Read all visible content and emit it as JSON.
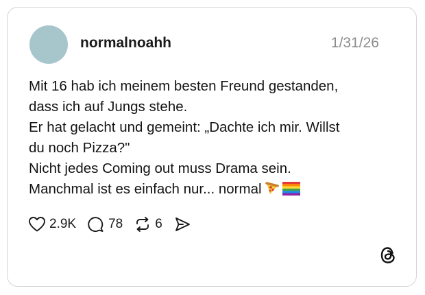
{
  "post": {
    "username": "normalnoahh",
    "date": "1/31/26",
    "lines": [
      "Mit 16 hab ich meinem besten Freund gestanden,",
      "dass ich auf Jungs stehe.",
      "Er hat gelacht und gemeint: „Dachte ich mir. Willst",
      "du noch Pizza?\"",
      "Nicht jedes Coming out muss Drama sein.",
      "Manchmal ist es einfach nur... normal"
    ],
    "emojis": [
      "pizza-emoji",
      "rainbow-flag-emoji"
    ]
  },
  "actions": {
    "likes": "2.9K",
    "replies": "78",
    "reposts": "6",
    "icons": [
      "heart-icon",
      "reply-bubble-icon",
      "repost-icon",
      "share-icon"
    ]
  },
  "branding": {
    "logo": "threads-logo-icon"
  },
  "colors": {
    "avatar": "#a6c6cc",
    "date": "#8c8c8c",
    "card_border": "#d4d4d4"
  }
}
